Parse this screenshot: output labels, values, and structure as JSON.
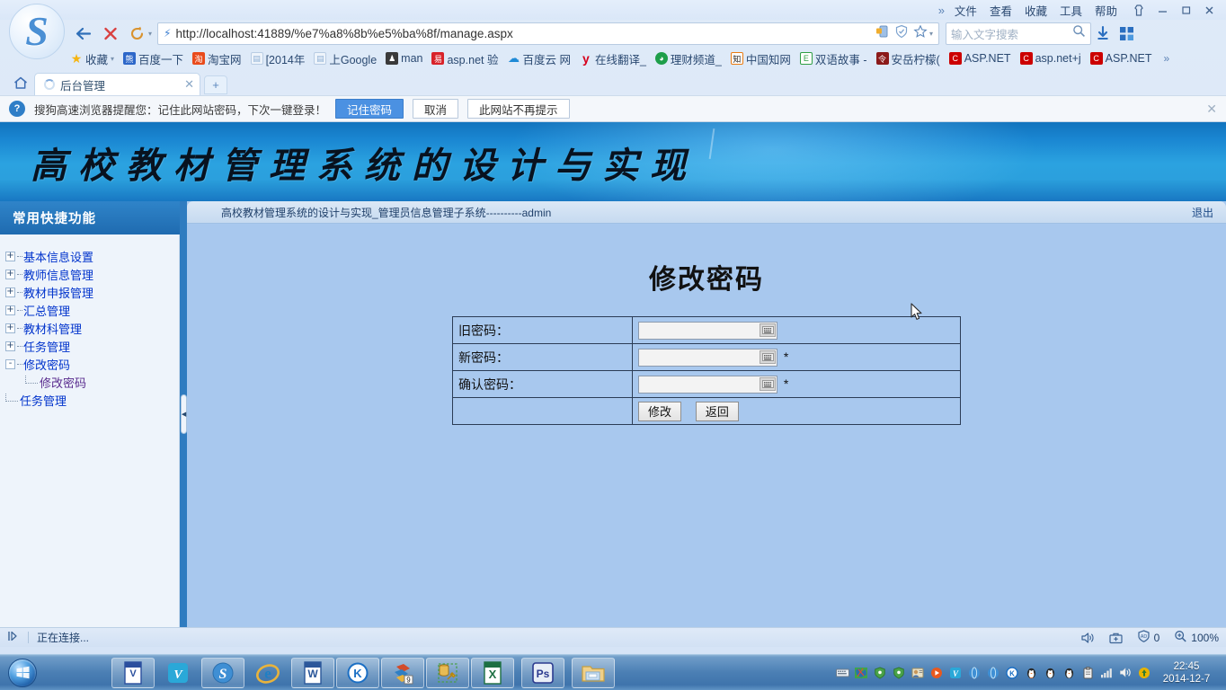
{
  "browser": {
    "menu": [
      "文件",
      "查看",
      "收藏",
      "工具",
      "帮助"
    ],
    "more_chevron": "»",
    "window_controls": {
      "skin": "skin-icon",
      "minimize": "–",
      "maximize": "▫",
      "close": "✕"
    },
    "nav": {
      "back": "←",
      "stop": "✕",
      "reload": "↻",
      "dropdown": "▾"
    },
    "url": "http://localhost:41889/%e7%a8%8b%e5%ba%8f/manage.aspx",
    "url_lightning": "⚡",
    "url_icons": [
      "extension-icon",
      "shield-icon",
      "star-icon",
      "star-dropdown-caret"
    ],
    "search": {
      "placeholder": "输入文字搜索",
      "icon": "search-icon"
    },
    "download_icon": "download-icon",
    "apps_icon": "apps-grid-icon",
    "logo_letter": "S",
    "bookmarks": [
      {
        "label": "收藏",
        "icon": "star-icon",
        "caret": "▾",
        "color": "#f5b512"
      },
      {
        "label": "百度一下",
        "icon": "baidu-icon",
        "color": "#2d67c9"
      },
      {
        "label": "淘宝网",
        "icon": "taobao-icon",
        "color": "#e94b1c"
      },
      {
        "label": "[2014年",
        "icon": "page-icon",
        "color": "#b9cde4"
      },
      {
        "label": "上Google",
        "icon": "page-icon",
        "color": "#b9cde4"
      },
      {
        "label": "man",
        "icon": "man-icon",
        "color": "#3a3a3a"
      },
      {
        "label": "asp.net 验",
        "icon": "aspnet-red-icon",
        "color": "#d8232a"
      },
      {
        "label": "百度云 网",
        "icon": "baiduyun-icon",
        "color": "#1f8ad6"
      },
      {
        "label": "在线翻译_",
        "icon": "youdao-icon",
        "color": "#d6001c"
      },
      {
        "label": "理财频道_",
        "icon": "finance-icon",
        "color": "#1e9e4a"
      },
      {
        "label": "中国知网",
        "icon": "cnki-icon",
        "color": "#e97b12"
      },
      {
        "label": "双语故事 -",
        "icon": "e-icon",
        "color": "#2f9e44"
      },
      {
        "label": "安岳柠檬(",
        "icon": "lemon-icon",
        "color": "#8b1a1a"
      },
      {
        "label": "ASP.NET",
        "icon": "c-red-icon",
        "color": "#cc0000"
      },
      {
        "label": "asp.net+j",
        "icon": "c-red-icon",
        "color": "#cc0000"
      },
      {
        "label": "ASP.NET",
        "icon": "c-red-icon",
        "color": "#cc0000"
      }
    ],
    "bookmarks_overflow": "»",
    "tab": {
      "title": "后台管理",
      "close": "✕",
      "loading": true
    },
    "new_tab": "+",
    "home_icon": "home-icon"
  },
  "notification": {
    "icon": "key-icon",
    "message": "搜狗高速浏览器提醒您：记住此网站密码，下次一键登录！",
    "buttons": [
      {
        "label": "记住密码",
        "primary": true
      },
      {
        "label": "取消",
        "primary": false
      },
      {
        "label": "此网站不再提示",
        "primary": false
      }
    ],
    "close": "✕"
  },
  "site": {
    "banner_title": "高校教材管理系统的设计与实现",
    "sidebar": {
      "header": "常用快捷功能",
      "items": [
        {
          "label": "基本信息设置",
          "expander": "+",
          "level": 0
        },
        {
          "label": "教师信息管理",
          "expander": "+",
          "level": 0
        },
        {
          "label": "教材申报管理",
          "expander": "+",
          "level": 0
        },
        {
          "label": "汇总管理",
          "expander": "+",
          "level": 0
        },
        {
          "label": "教材科管理",
          "expander": "+",
          "level": 0
        },
        {
          "label": "任务管理",
          "expander": "+",
          "level": 0
        },
        {
          "label": "修改密码",
          "expander": "-",
          "level": 0
        },
        {
          "label": "修改密码",
          "expander": "",
          "level": 1
        },
        {
          "label": "任务管理",
          "expander": "",
          "level": 0
        }
      ]
    },
    "content": {
      "breadcrumb": "高校教材管理系统的设计与实现_管理员信息管理子系统----------admin",
      "logout": "退出",
      "page_title": "修改密码",
      "form": {
        "rows": [
          {
            "label": "旧密码：",
            "value": "",
            "required": ""
          },
          {
            "label": "新密码：",
            "value": "",
            "required": "*"
          },
          {
            "label": "确认密码：",
            "value": "",
            "required": "*"
          }
        ],
        "keyboard_icon": "soft-keyboard-icon",
        "submit": "修改",
        "back": "返回"
      }
    }
  },
  "statusbar": {
    "left_icon": "sidebar-toggle-icon",
    "text": "正在连接...",
    "speaker_icon": "speaker-icon",
    "toolbox_icon": "toolbox-icon",
    "adblock_icon": "adblock-icon",
    "adblock_count": "0",
    "zoom_icon": "zoom-icon",
    "zoom_level": "100%"
  },
  "taskbar": {
    "start": "windows-orb",
    "apps": [
      {
        "name": "visio-icon",
        "glyph": "V",
        "color": "#2b4f9e"
      },
      {
        "name": "vegas-icon",
        "glyph": "V",
        "color": "#2aa8d8"
      },
      {
        "name": "sogou-browser-icon",
        "glyph": "S",
        "color": "#3f8fd4"
      },
      {
        "name": "internet-explorer-icon",
        "glyph": "e",
        "color": "#1f7fc4"
      },
      {
        "name": "word-icon",
        "glyph": "W",
        "color": "#2b579a"
      },
      {
        "name": "kingsoft-icon",
        "glyph": "K",
        "color": "#1b6fc4"
      },
      {
        "name": "winrar-icon",
        "glyph": "9",
        "color": "#d24b2a"
      },
      {
        "name": "sql-tools-icon",
        "glyph": "⚒",
        "color": "#d0a02a"
      },
      {
        "name": "excel-icon",
        "glyph": "X",
        "color": "#1d6f42"
      },
      {
        "name": "photoshop-icon",
        "glyph": "Ps",
        "color": "#2b3a8f"
      },
      {
        "name": "file-explorer-icon",
        "glyph": "🗂",
        "color": "#e8b84b"
      }
    ],
    "tray": [
      "keyboard-ime-icon",
      "network-map-icon",
      "shield-green-icon",
      "shield-green-icon2",
      "user-icon",
      "media-player-icon",
      "vegas-tray-icon",
      "browser-tray-icon",
      "browser-tray-icon2",
      "kingsoft-tray-icon",
      "qq-penguin-icon",
      "qq-penguin-icon2",
      "qq-penguin-icon3",
      "clipboard-icon",
      "signal-icon",
      "volume-icon",
      "update-icon"
    ],
    "clock_time": "22:45",
    "clock_date": "2014-12-7"
  },
  "colors": {
    "accent": "#2b7cc0",
    "banner_blue": "#1a87d2",
    "content_bg": "#a8c8ee",
    "sidebar_bg": "#eef4fb",
    "link": "#0033cc",
    "child_link": "#5a2d8f"
  }
}
